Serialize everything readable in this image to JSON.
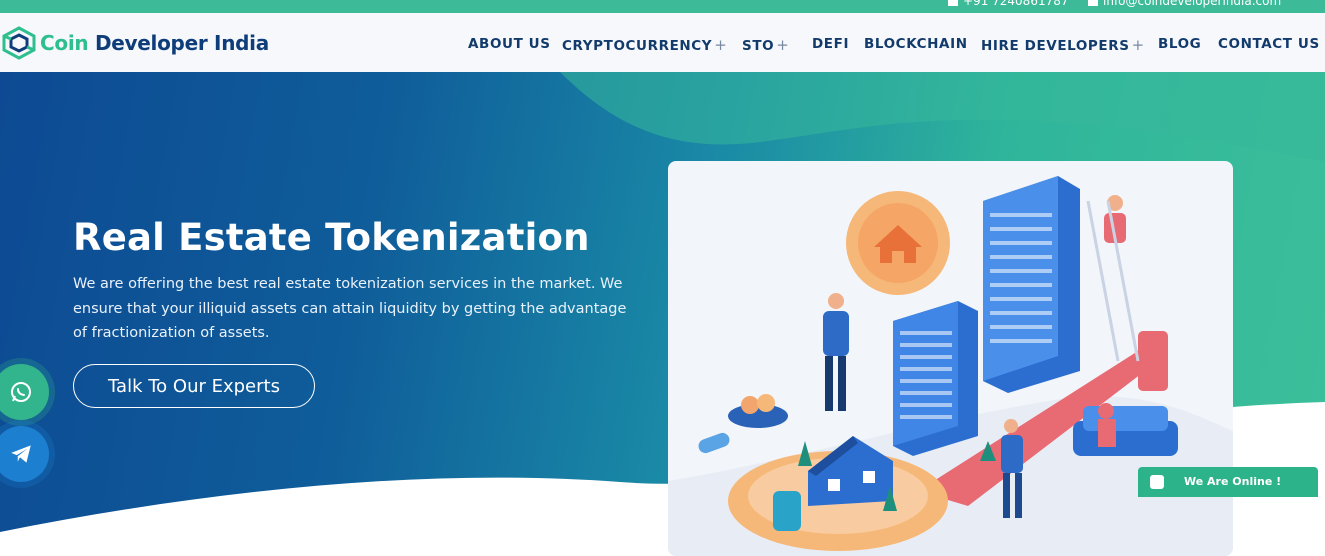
{
  "topbar": {
    "phone": "+91 7240861787",
    "email": "info@coindeveloperindia.com",
    "phone_icon": "phone-icon",
    "email_icon": "envelope-icon"
  },
  "brand": {
    "name_part1": "Coin",
    "name_part2": "Developer India",
    "logo_icon": "cube-logo-icon",
    "colors": {
      "green": "#2fbf8f",
      "navy": "#0f3d7a"
    }
  },
  "nav": {
    "items": [
      {
        "label": "ABOUT US",
        "has_submenu": false
      },
      {
        "label": "CRYPTOCURRENCY",
        "has_submenu": true
      },
      {
        "label": "STO",
        "has_submenu": true
      },
      {
        "label": "DEFI",
        "has_submenu": false
      },
      {
        "label": "BLOCKCHAIN",
        "has_submenu": false
      },
      {
        "label": "HIRE DEVELOPERS",
        "has_submenu": true
      },
      {
        "label": "BLOG",
        "has_submenu": false
      },
      {
        "label": "CONTACT US",
        "has_submenu": false
      }
    ],
    "submenu_symbol": "+"
  },
  "hero": {
    "title": "Real Estate Tokenization",
    "description": "We are offering the best real estate tokenization services in the market. We ensure that your illiquid assets can attain liquidity by getting the advantage of fractionization of assets.",
    "cta_label": "Talk To Our Experts",
    "illustration": "real-estate-tokenization-illustration",
    "gradient": {
      "from": "#0d4a93",
      "to": "#3cbf9a"
    }
  },
  "floating": {
    "whatsapp_icon": "whatsapp-icon",
    "telegram_icon": "telegram-icon"
  },
  "chat": {
    "label": "We Are Online !",
    "icon": "chat-bubble-icon"
  }
}
